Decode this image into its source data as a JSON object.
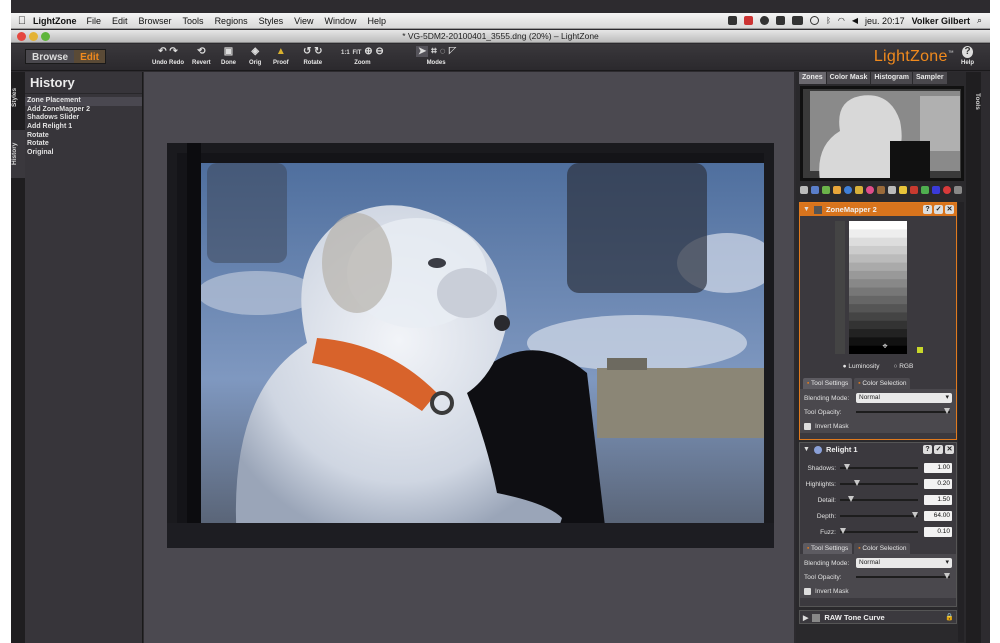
{
  "menubar": {
    "app_name": "LightZone",
    "items": [
      "File",
      "Edit",
      "Browser",
      "Tools",
      "Regions",
      "Styles",
      "View",
      "Window",
      "Help"
    ],
    "clock": "jeu. 20:17",
    "user": "Volker Gilbert"
  },
  "window": {
    "title": "* VG-5DM2-20100401_3555.dng (20%) – LightZone"
  },
  "toolbar": {
    "browse": "Browse",
    "edit": "Edit",
    "undo_redo": "Undo Redo",
    "revert": "Revert",
    "done": "Done",
    "orig": "Orig",
    "proof": "Proof",
    "rotate": "Rotate",
    "zoom_1to1": "1:1",
    "zoom_fit": "FIT",
    "zoom": "Zoom",
    "modes": "Modes",
    "help": "Help",
    "logo": "LightZone",
    "logo_tm": "™"
  },
  "sidetabs": {
    "styles": "Styles",
    "history": "History",
    "tools": "Tools"
  },
  "history": {
    "title": "History",
    "items": [
      "Zone Placement",
      "Add ZoneMapper 2",
      "Shadows Slider",
      "Add Relight 1",
      "Rotate",
      "Rotate",
      "Original"
    ]
  },
  "right": {
    "tabs": [
      "Zones",
      "Color Mask",
      "Histogram",
      "Sampler"
    ],
    "zonemapper": {
      "title": "ZoneMapper 2",
      "luminosity": "Luminosity",
      "rgb": "RGB",
      "tool_settings": "Tool Settings",
      "color_selection": "Color Selection",
      "blending_label": "Blending Mode:",
      "blending_value": "Normal",
      "opacity_label": "Tool Opacity:",
      "invert_mask": "Invert Mask"
    },
    "relight": {
      "title": "Relight 1",
      "sliders": [
        {
          "label": "Shadows:",
          "value": "1.00"
        },
        {
          "label": "Highlights:",
          "value": "0.20"
        },
        {
          "label": "Detail:",
          "value": "1.50"
        },
        {
          "label": "Depth:",
          "value": "64.00"
        },
        {
          "label": "Fuzz:",
          "value": "0.10"
        }
      ],
      "tool_settings": "Tool Settings",
      "color_selection": "Color Selection",
      "blending_label": "Blending Mode:",
      "blending_value": "Normal",
      "opacity_label": "Tool Opacity:",
      "invert_mask": "Invert Mask"
    },
    "raw_tone_curve": "RAW Tone Curve"
  },
  "colors": {
    "accent": "#f18a1d",
    "panel": "#37353a",
    "canvas": "#4b4950"
  }
}
